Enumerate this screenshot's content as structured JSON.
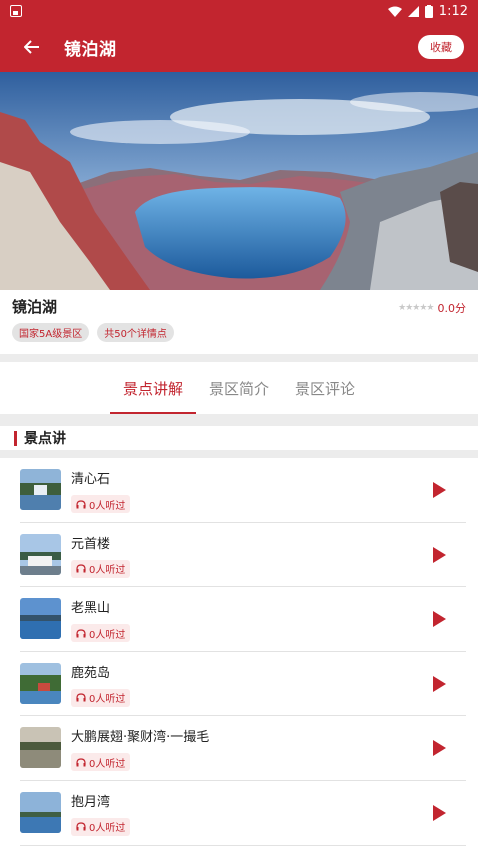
{
  "status_bar": {
    "time": "1:12"
  },
  "app_bar": {
    "title": "镜泊湖",
    "favorite_label": "收藏"
  },
  "scenic": {
    "name": "镜泊湖",
    "score": "0.0分",
    "rating_stars": 0,
    "tags": [
      "国家5A级景区",
      "共50个详情点"
    ]
  },
  "tabs": [
    {
      "label": "景点讲解",
      "active": true
    },
    {
      "label": "景区简介",
      "active": false
    },
    {
      "label": "景区评论",
      "active": false
    }
  ],
  "section": {
    "title": "景点讲"
  },
  "spots": [
    {
      "name": "清心石",
      "listens": "0人听过"
    },
    {
      "name": "元首楼",
      "listens": "0人听过"
    },
    {
      "name": "老黑山",
      "listens": "0人听过"
    },
    {
      "name": "鹿苑岛",
      "listens": "0人听过"
    },
    {
      "name": "大鹏展翅·聚财湾·一撮毛",
      "listens": "0人听过"
    },
    {
      "name": "抱月湾",
      "listens": "0人听过"
    }
  ],
  "colors": {
    "primary": "#c2252f",
    "background": "#ececec"
  }
}
